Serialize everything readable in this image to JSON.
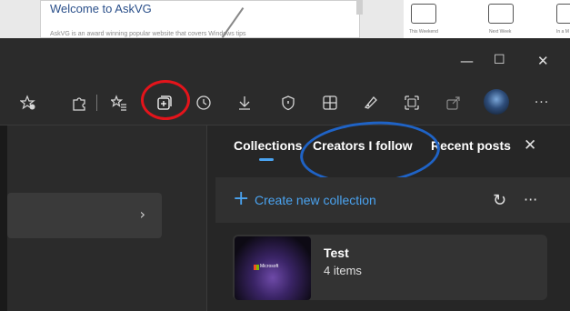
{
  "background_page": {
    "card_title": "Welcome to AskVG",
    "card_body": "AskVG is an award winning popular website that covers Windows tips",
    "tiles": [
      {
        "label": "This Weekend",
        "icon": "sofa-icon"
      },
      {
        "label": "Next Week",
        "icon": "briefcase-icon"
      },
      {
        "label": "In a M",
        "icon": "calendar-icon"
      }
    ]
  },
  "window": {
    "minimize_icon": "—",
    "maximize_icon": "☐",
    "close_icon": "✕"
  },
  "toolbar": {
    "icons": [
      "add-favorite-icon",
      "extensions-icon",
      "favorites-icon",
      "collections-icon",
      "history-icon",
      "downloads-icon",
      "browser-essentials-icon",
      "workspaces-icon",
      "web-capture-icon",
      "screenshot-icon",
      "share-icon",
      "profile-avatar-icon",
      "more-icon"
    ],
    "more_label": "···"
  },
  "collections_panel": {
    "tabs": [
      {
        "label": "Collections",
        "selected": true
      },
      {
        "label": "Creators I follow",
        "selected": false
      },
      {
        "label": "Recent posts",
        "selected": false
      }
    ],
    "close_label": "✕",
    "create_label": "Create new collection",
    "create_plus": "+",
    "refresh_icon": "↻",
    "more_label": "···",
    "items": [
      {
        "name": "Test",
        "count": "4 items",
        "thumb_text": "Microsoft"
      }
    ]
  },
  "left_pane": {
    "chevron": "›"
  },
  "annotations": {
    "red_circle_color": "#e4141b",
    "blue_oval_color": "#1f63c6"
  }
}
